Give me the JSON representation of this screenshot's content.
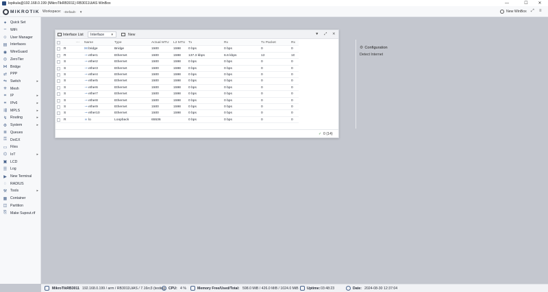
{
  "window_title": "lopikula@192.168.0.199 (MikroTikRB3011) RB3011UiAS WinBox",
  "window_controls": {
    "minimize": "—",
    "maximize": "☐",
    "close": "✕"
  },
  "topbar": {
    "brand": "MIKROTIK",
    "workspace_label": "Workspace:",
    "workspace_value": "‹Default›",
    "new_winbox": "New WinBox"
  },
  "sidebar": {
    "items": [
      {
        "label": "Quick Set",
        "icon": "wand-icon",
        "arrow": false
      },
      {
        "label": "WiFi",
        "icon": "wifi-icon",
        "arrow": false
      },
      {
        "label": "User Manager",
        "icon": "users-icon",
        "arrow": false
      },
      {
        "label": "Interfaces",
        "icon": "interfaces-icon",
        "arrow": false
      },
      {
        "label": "WireGuard",
        "icon": "wireguard-icon",
        "arrow": false
      },
      {
        "label": "ZeroTier",
        "icon": "zerotier-icon",
        "arrow": false
      },
      {
        "label": "Bridge",
        "icon": "bridge-icon",
        "arrow": false
      },
      {
        "label": "PPP",
        "icon": "ppp-icon",
        "arrow": false
      },
      {
        "label": "Switch",
        "icon": "switch-icon",
        "arrow": true
      },
      {
        "label": "Mesh",
        "icon": "mesh-icon",
        "arrow": false
      },
      {
        "label": "IP",
        "icon": "ip-icon",
        "arrow": true
      },
      {
        "label": "IPv6",
        "icon": "ipv6-icon",
        "arrow": true
      },
      {
        "label": "MPLS",
        "icon": "mpls-icon",
        "arrow": true
      },
      {
        "label": "Routing",
        "icon": "routing-icon",
        "arrow": true
      },
      {
        "label": "System",
        "icon": "system-icon",
        "arrow": true
      },
      {
        "label": "Queues",
        "icon": "queues-icon",
        "arrow": false
      },
      {
        "label": "Dot1X",
        "icon": "dot1x-icon",
        "arrow": false
      },
      {
        "label": "Files",
        "icon": "files-icon",
        "arrow": false
      },
      {
        "label": "IoT",
        "icon": "iot-icon",
        "arrow": true
      },
      {
        "label": "LCD",
        "icon": "lcd-icon",
        "arrow": false
      },
      {
        "label": "Log",
        "icon": "log-icon",
        "arrow": false
      },
      {
        "label": "New Terminal",
        "icon": "terminal-icon",
        "arrow": false
      },
      {
        "label": "RADIUS",
        "icon": "radius-icon",
        "arrow": false
      },
      {
        "label": "Tools",
        "icon": "tools-icon",
        "arrow": true
      },
      {
        "label": "Container",
        "icon": "container-icon",
        "arrow": false
      },
      {
        "label": "Partition",
        "icon": "partition-icon",
        "arrow": false
      },
      {
        "label": "Make Supout.rif",
        "icon": "supout-icon",
        "arrow": false
      }
    ]
  },
  "interface_window": {
    "title": "Interface List",
    "tab_value": "Interface",
    "new_label": "New",
    "columns": [
      "",
      "",
      "Name",
      "Type",
      "Actual MTU",
      "L2 MTU",
      "Tx",
      "Rx",
      "Tx Packet",
      "Rx"
    ],
    "rows": [
      {
        "flag": "R",
        "name": "bridge",
        "type": "Bridge",
        "mtu": "1500",
        "l2mtu": "1598",
        "tx": "0 bps",
        "rx": "0 bps",
        "txp": "0",
        "rxp": "0"
      },
      {
        "flag": "R",
        "name": "ether1",
        "type": "Ethernet",
        "mtu": "1500",
        "l2mtu": "1598",
        "tx": "137.3 kbps",
        "rx": "6.6 kbps",
        "txp": "13",
        "rxp": "10"
      },
      {
        "flag": "S",
        "name": "ether2",
        "type": "Ethernet",
        "mtu": "1500",
        "l2mtu": "1598",
        "tx": "0 bps",
        "rx": "0 bps",
        "txp": "0",
        "rxp": "0"
      },
      {
        "flag": "S",
        "name": "ether3",
        "type": "Ethernet",
        "mtu": "1500",
        "l2mtu": "1598",
        "tx": "0 bps",
        "rx": "0 bps",
        "txp": "0",
        "rxp": "0"
      },
      {
        "flag": "S",
        "name": "ether4",
        "type": "Ethernet",
        "mtu": "1500",
        "l2mtu": "1598",
        "tx": "0 bps",
        "rx": "0 bps",
        "txp": "0",
        "rxp": "0"
      },
      {
        "flag": "S",
        "name": "ether5",
        "type": "Ethernet",
        "mtu": "1500",
        "l2mtu": "1598",
        "tx": "0 bps",
        "rx": "0 bps",
        "txp": "0",
        "rxp": "0"
      },
      {
        "flag": "S",
        "name": "ether6",
        "type": "Ethernet",
        "mtu": "1500",
        "l2mtu": "1598",
        "tx": "0 bps",
        "rx": "0 bps",
        "txp": "0",
        "rxp": "0"
      },
      {
        "flag": "S",
        "name": "ether7",
        "type": "Ethernet",
        "mtu": "1500",
        "l2mtu": "1598",
        "tx": "0 bps",
        "rx": "0 bps",
        "txp": "0",
        "rxp": "0"
      },
      {
        "flag": "S",
        "name": "ether8",
        "type": "Ethernet",
        "mtu": "1500",
        "l2mtu": "1598",
        "tx": "0 bps",
        "rx": "0 bps",
        "txp": "0",
        "rxp": "0"
      },
      {
        "flag": "S",
        "name": "ether9",
        "type": "Ethernet",
        "mtu": "1500",
        "l2mtu": "1598",
        "tx": "0 bps",
        "rx": "0 bps",
        "txp": "0",
        "rxp": "0"
      },
      {
        "flag": "S",
        "name": "ether10",
        "type": "Ethernet",
        "mtu": "1500",
        "l2mtu": "1598",
        "tx": "0 bps",
        "rx": "0 bps",
        "txp": "0",
        "rxp": "0"
      },
      {
        "flag": "R",
        "name": "lo",
        "type": "Loopback",
        "mtu": "65536",
        "l2mtu": "",
        "tx": "0 bps",
        "rx": "0 bps",
        "txp": "0",
        "rxp": "0"
      }
    ],
    "side_panel": {
      "configuration": "Configuration",
      "detect_internet": "Detect Internet"
    },
    "footer_count": "0 (14)"
  },
  "statusbar": {
    "device": "MikroTikRB3011",
    "details": "192.168.0.199 / arm / RB3011UiAS / 7.16rc3 (testing)",
    "cpu_label": "CPU:",
    "cpu_value": "4 %",
    "mem_label": "Memory Free/Used/Total:",
    "mem_value": "598.0 MiB / 426.0 MiB / 1024.0 MiB",
    "uptime_label": "Uptime:",
    "uptime_value": "03:48:23",
    "date_label": "Date:",
    "date_value": "2024-08-30 12:37:04"
  },
  "colors": {
    "accent": "#48638c",
    "ok": "#3d8a3d"
  }
}
